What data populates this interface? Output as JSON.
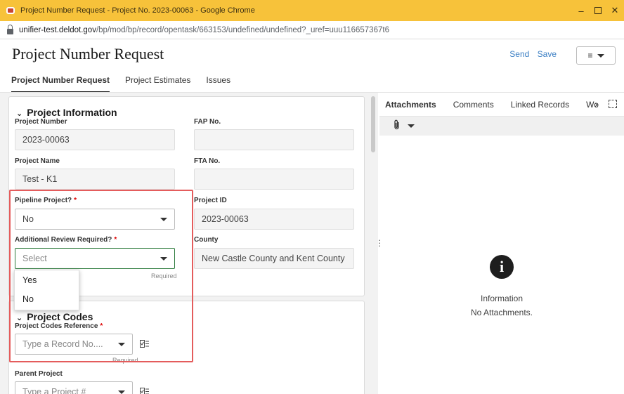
{
  "window": {
    "title": "Project Number Request - Project No. 2023-00063 - Google Chrome",
    "controls": {
      "minimize": "–",
      "close": "✕"
    }
  },
  "browser": {
    "url_domain": "unifier-test.deldot.gov",
    "url_path": "/bp/mod/bp/record/opentask/663153/undefined/undefined?_uref=uuu116657367t6"
  },
  "header": {
    "title": "Project Number Request",
    "send_label": "Send",
    "save_label": "Save",
    "menu_icon": "≡"
  },
  "tabs": [
    {
      "label": "Project Number Request",
      "active": true
    },
    {
      "label": "Project Estimates",
      "active": false
    },
    {
      "label": "Issues",
      "active": false
    }
  ],
  "project_information": {
    "section_title": "Project Information",
    "project_number": {
      "label": "Project Number",
      "value": "2023-00063"
    },
    "fap_no": {
      "label": "FAP No.",
      "value": ""
    },
    "project_name": {
      "label": "Project Name",
      "value": "Test - K1"
    },
    "fta_no": {
      "label": "FTA No.",
      "value": ""
    },
    "pipeline_project": {
      "label": "Pipeline Project?",
      "required_mark": "*",
      "value": "No"
    },
    "project_id": {
      "label": "Project ID",
      "value": "2023-00063"
    },
    "additional_review": {
      "label": "Additional Review Required?",
      "required_mark": "*",
      "placeholder": "Select",
      "hint": "Required"
    },
    "county": {
      "label": "County",
      "value": "New Castle County and Kent County"
    },
    "dropdown_options": [
      "Yes",
      "No"
    ]
  },
  "project_codes": {
    "section_title": "Project Codes",
    "codes_reference": {
      "label": "Project Codes Reference",
      "required_mark": "*",
      "placeholder": "Type a Record No....",
      "hint": "Required"
    },
    "parent_project": {
      "label": "Parent Project",
      "placeholder": "Type a Project #"
    }
  },
  "right_panel": {
    "tabs": [
      "Attachments",
      "Comments",
      "Linked Records",
      "Wo"
    ],
    "active_tab": "Attachments",
    "more_icon": "›",
    "empty_icon": "i",
    "empty_title": "Information",
    "empty_message": "No Attachments."
  },
  "colors": {
    "titlebar": "#f7c23a",
    "link": "#3b7fc4",
    "required": "#dd0000",
    "highlight": "#e45c5c",
    "focus": "#2b7a3b"
  }
}
